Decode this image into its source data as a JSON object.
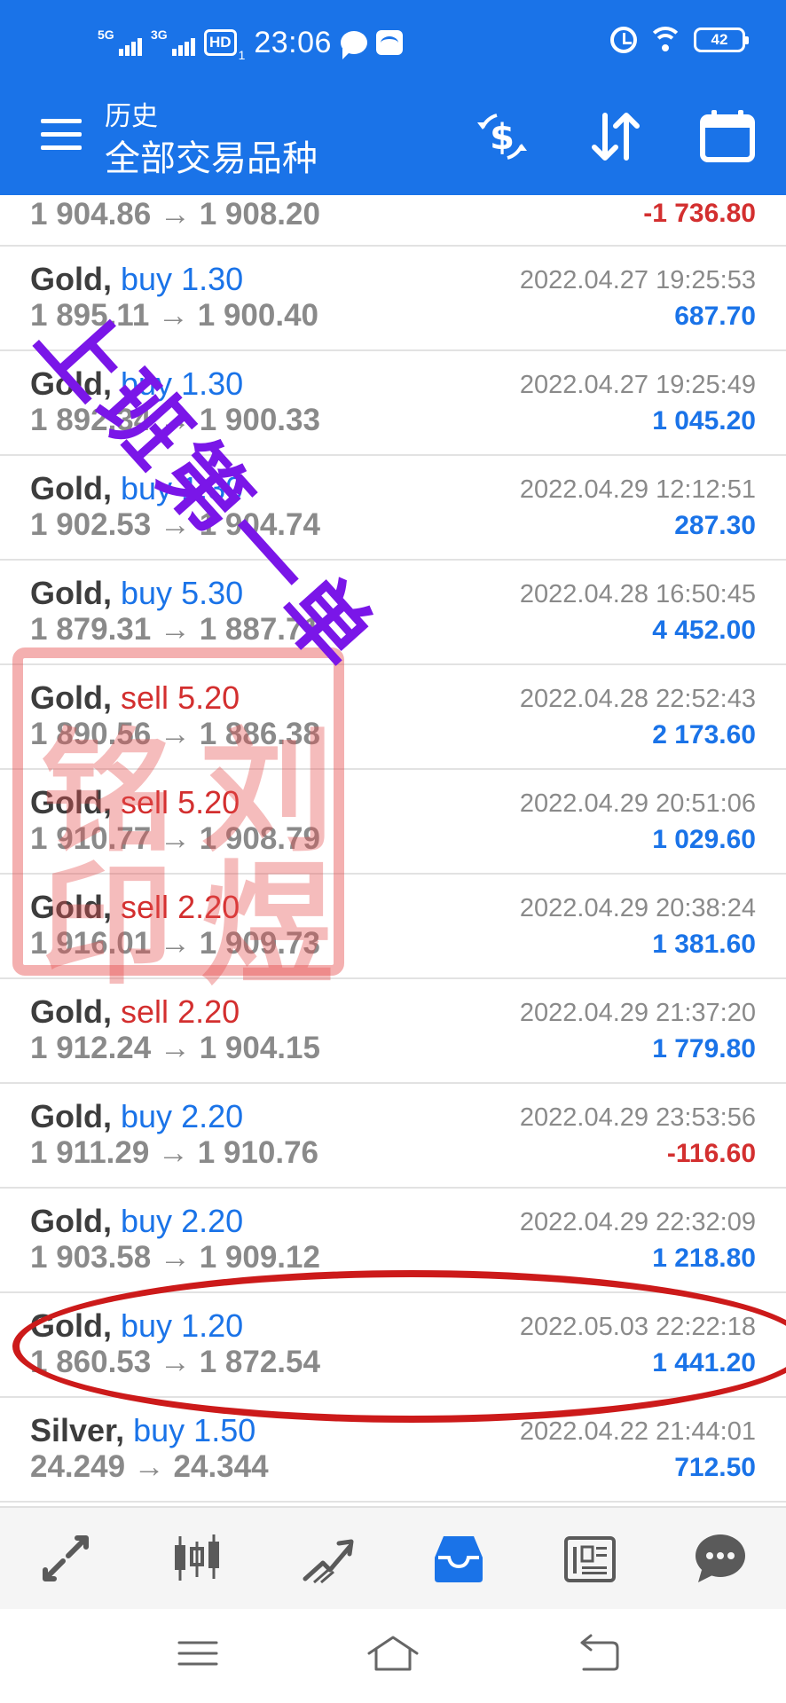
{
  "status_bar": {
    "signal1": "5G",
    "signal2": "3G",
    "hd": "HD",
    "hd_sub": "1",
    "time": "23:06",
    "battery": "42"
  },
  "app_bar": {
    "subtitle": "历史",
    "title": "全部交易品种"
  },
  "trades": [
    {
      "symbol": "",
      "side": "",
      "volume": "",
      "open": "1 904.86",
      "close": "1 908.20",
      "date": "",
      "profit": "-1 736.80",
      "profit_sign": "neg"
    },
    {
      "symbol": "Gold,",
      "side": "buy",
      "volume": "1.30",
      "open": "1 895.11",
      "close": "1 900.40",
      "date": "2022.04.27 19:25:53",
      "profit": "687.70",
      "profit_sign": "pos"
    },
    {
      "symbol": "Gold,",
      "side": "buy",
      "volume": "1.30",
      "open": "1 892.34",
      "close": "1 900.33",
      "date": "2022.04.27 19:25:49",
      "profit": "1 045.20",
      "profit_sign": "pos"
    },
    {
      "symbol": "Gold,",
      "side": "buy",
      "volume": "1.30",
      "open": "1 902.53",
      "close": "1 904.74",
      "date": "2022.04.29 12:12:51",
      "profit": "287.30",
      "profit_sign": "pos"
    },
    {
      "symbol": "Gold,",
      "side": "buy",
      "volume": "5.30",
      "open": "1 879.31",
      "close": "1 887.71",
      "date": "2022.04.28 16:50:45",
      "profit": "4 452.00",
      "profit_sign": "pos"
    },
    {
      "symbol": "Gold,",
      "side": "sell",
      "volume": "5.20",
      "open": "1 890.56",
      "close": "1 886.38",
      "date": "2022.04.28 22:52:43",
      "profit": "2 173.60",
      "profit_sign": "pos"
    },
    {
      "symbol": "Gold,",
      "side": "sell",
      "volume": "5.20",
      "open": "1 910.77",
      "close": "1 908.79",
      "date": "2022.04.29 20:51:06",
      "profit": "1 029.60",
      "profit_sign": "pos"
    },
    {
      "symbol": "Gold,",
      "side": "sell",
      "volume": "2.20",
      "open": "1 916.01",
      "close": "1 909.73",
      "date": "2022.04.29 20:38:24",
      "profit": "1 381.60",
      "profit_sign": "pos"
    },
    {
      "symbol": "Gold,",
      "side": "sell",
      "volume": "2.20",
      "open": "1 912.24",
      "close": "1 904.15",
      "date": "2022.04.29 21:37:20",
      "profit": "1 779.80",
      "profit_sign": "pos"
    },
    {
      "symbol": "Gold,",
      "side": "buy",
      "volume": "2.20",
      "open": "1 911.29",
      "close": "1 910.76",
      "date": "2022.04.29 23:53:56",
      "profit": "-116.60",
      "profit_sign": "neg"
    },
    {
      "symbol": "Gold,",
      "side": "buy",
      "volume": "2.20",
      "open": "1 903.58",
      "close": "1 909.12",
      "date": "2022.04.29 22:32:09",
      "profit": "1 218.80",
      "profit_sign": "pos"
    },
    {
      "symbol": "Gold,",
      "side": "buy",
      "volume": "1.20",
      "open": "1 860.53",
      "close": "1 872.54",
      "date": "2022.05.03 22:22:18",
      "profit": "1 441.20",
      "profit_sign": "pos"
    },
    {
      "symbol": "Silver,",
      "side": "buy",
      "volume": "1.50",
      "open": "24.249",
      "close": "24.344",
      "date": "2022.04.22 21:44:01",
      "profit": "712.50",
      "profit_sign": "pos"
    }
  ],
  "arrow": "→",
  "overlays": {
    "handwriting": "上班第一单",
    "stamp": [
      "刘",
      "铭",
      "煜",
      "印"
    ]
  },
  "bottom_nav": [
    "quotes-icon",
    "chart-icon",
    "trade-icon",
    "history-icon",
    "news-icon",
    "chat-icon"
  ],
  "colors": {
    "primary": "#1a73e8",
    "buy": "#1a73e8",
    "sell": "#d32f2f",
    "profit_pos": "#1a73e8",
    "profit_neg": "#d32f2f",
    "handwriting": "#7a16e8",
    "stamp": "#e65050",
    "circle": "#cc1a1a"
  }
}
